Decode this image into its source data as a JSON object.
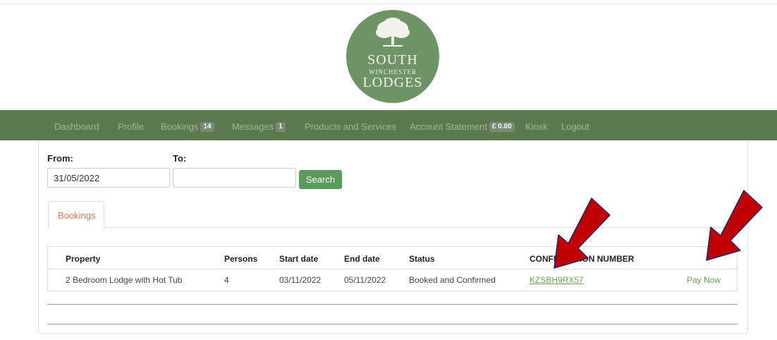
{
  "logo": {
    "line1": "SOUTH",
    "line2": "WINCHESTER",
    "line3": "LODGES"
  },
  "nav": {
    "items": [
      {
        "label": "Dashboard"
      },
      {
        "label": "Profile"
      },
      {
        "label": "Bookings",
        "badge": "14"
      },
      {
        "label": "Messages",
        "badge": "1"
      },
      {
        "label": "Products and Services"
      },
      {
        "label": "Account Statement",
        "badge": "£ 0.00"
      },
      {
        "label": "Kiosk"
      },
      {
        "label": "Logout"
      }
    ]
  },
  "filter": {
    "from_label": "From:",
    "to_label": "To:",
    "from_value": "31/05/2022",
    "to_value": "",
    "search_label": "Search"
  },
  "tabs": [
    {
      "label": "Bookings"
    }
  ],
  "table": {
    "headers": [
      "Property",
      "Persons",
      "Start date",
      "End date",
      "Status",
      "CONFIRMATION NUMBER"
    ],
    "rows": [
      {
        "property": "2 Bedroom Lodge with Hot Tub",
        "persons": "4",
        "start_date": "03/11/2022",
        "end_date": "05/11/2022",
        "status": "Booked and Confirmed",
        "confirmation": "KZSBH9RX57",
        "action": "Pay Now"
      }
    ]
  },
  "colors": {
    "nav_bg": "#5b7b4f",
    "logo_bg": "#6e9466",
    "accent_green": "#5b9a5c",
    "link_green": "#6aa356",
    "tab_orange": "#e07a56",
    "arrow_red": "#c00000",
    "arrow_outline": "#1f2a6b"
  }
}
